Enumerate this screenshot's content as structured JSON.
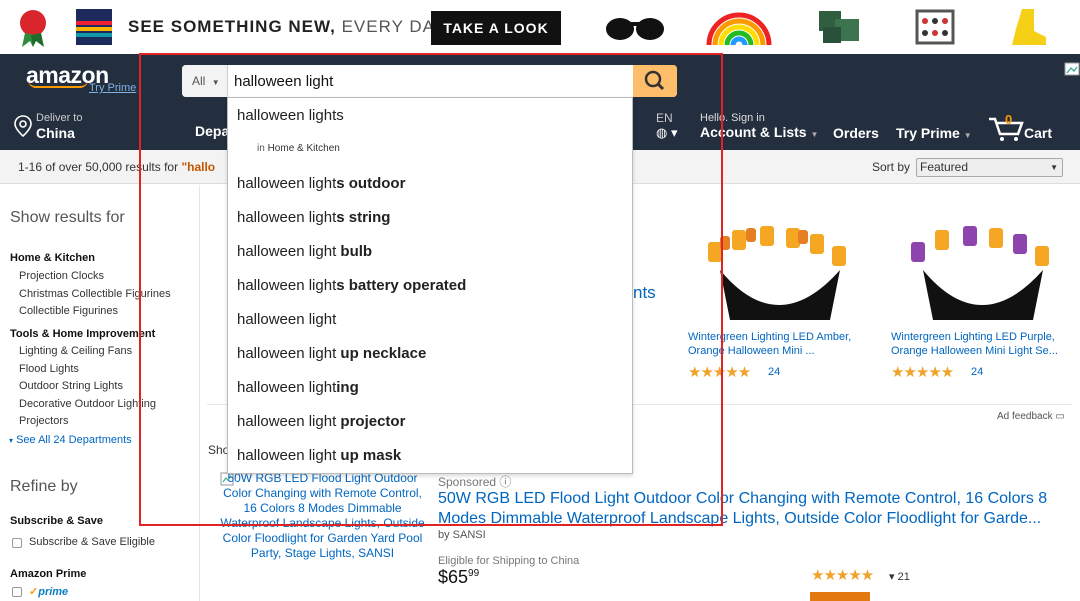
{
  "promo": {
    "text_bold": "SEE SOMETHING NEW,",
    "text_light": "EVERY DAY.",
    "cta": "TAKE A LOOK",
    "thumbs": [
      "ribbon-thumb",
      "sweater-thumb",
      "sunglasses-thumb",
      "rainbow-thumb",
      "pillows-thumb",
      "connect-four-thumb",
      "boot-thumb"
    ]
  },
  "header": {
    "logo": "amazon",
    "logo_sub": "Try Prime",
    "search_scope": "All",
    "search_value": "halloween light",
    "deliver_line1": "Deliver to",
    "deliver_line2": "China",
    "departments": "Depa",
    "lang": "EN",
    "account_line1": "Hello. Sign in",
    "account_line2": "Account & Lists",
    "orders": "Orders",
    "try_prime": "Try Prime",
    "cart_count": "0",
    "cart_label": "Cart"
  },
  "results": {
    "count_text": "1-16 of over 50,000 results for ",
    "query_fragment": "\"hallo",
    "sort_label": "Sort by",
    "sort_value": "Featured"
  },
  "sidebar": {
    "show_results_for": "Show results for",
    "cat1": "Home & Kitchen",
    "cat1_links": [
      "Projection Clocks",
      "Christmas Collectible Figurines",
      "Collectible Figurines"
    ],
    "cat2": "Tools & Home Improvement",
    "cat2_links": [
      "Lighting & Ceiling Fans",
      "Flood Lights",
      "Outdoor String Lights",
      "Decorative Outdoor Lighting",
      "Projectors"
    ],
    "see_all": "See All 24 Departments",
    "refine_by": "Refine by",
    "subscribe_head": "Subscribe & Save",
    "subscribe_opt": "Subscribe & Save Eligible",
    "prime_head": "Amazon Prime",
    "prime_opt": "prime"
  },
  "autocomplete": {
    "items": [
      {
        "typed": "halloween light",
        "completion": "s",
        "regular_completion": true
      },
      {
        "typed": "halloween light",
        "completion": "s outdoor"
      },
      {
        "typed": "halloween light",
        "completion": "s string"
      },
      {
        "typed": "halloween light",
        "completion": " bulb"
      },
      {
        "typed": "halloween light",
        "completion": "s battery operated"
      },
      {
        "typed": "halloween light",
        "completion": ""
      },
      {
        "typed": "halloween light",
        "completion": " up necklace"
      },
      {
        "typed": "halloween light",
        "completion": "ing"
      },
      {
        "typed": "halloween light",
        "completion": " projector"
      },
      {
        "typed": "halloween light",
        "completion": " up mask"
      }
    ],
    "sub_prefix": "in",
    "sub_department": "Home & Kitchen"
  },
  "products": {
    "partial_heading": "nts",
    "p1_title": "Wintergreen Lighting LED Amber, Orange Halloween Mini ...",
    "p1_stars": "★★★★★",
    "p1_reviews": "24",
    "p2_title": "Wintergreen Lighting LED Purple, Orange Halloween Mini Light Se...",
    "p2_stars": "★★★★★",
    "p2_reviews": "24",
    "ad_feedback": "Ad feedback",
    "sh_label": "Sho",
    "img_alt": "50W RGB LED Flood Light Outdoor Color Changing with Remote Control, 16 Colors 8 Modes Dimmable Waterproof Landscape Lights, Outside Color Floodlight for Garden Yard Pool Party, Stage Lights, SANSI",
    "sponsored": "Sponsored ⓘ",
    "big_title": "50W RGB LED Flood Light Outdoor Color Changing with Remote Control, 16 Colors 8 Modes Dimmable Waterproof Landscape Lights, Outside Color Floodlight for Garde...",
    "by": "by SANSI",
    "shipping": "Eligible for Shipping to China",
    "price_dollars": "$65",
    "price_cents": "99",
    "big_stars": "★★★★★",
    "big_reviews": "▾ 21"
  },
  "colors": {
    "nav_bg": "#232f3e",
    "accent": "#febd69",
    "highlight": "#e02424",
    "link": "#0066c0"
  }
}
